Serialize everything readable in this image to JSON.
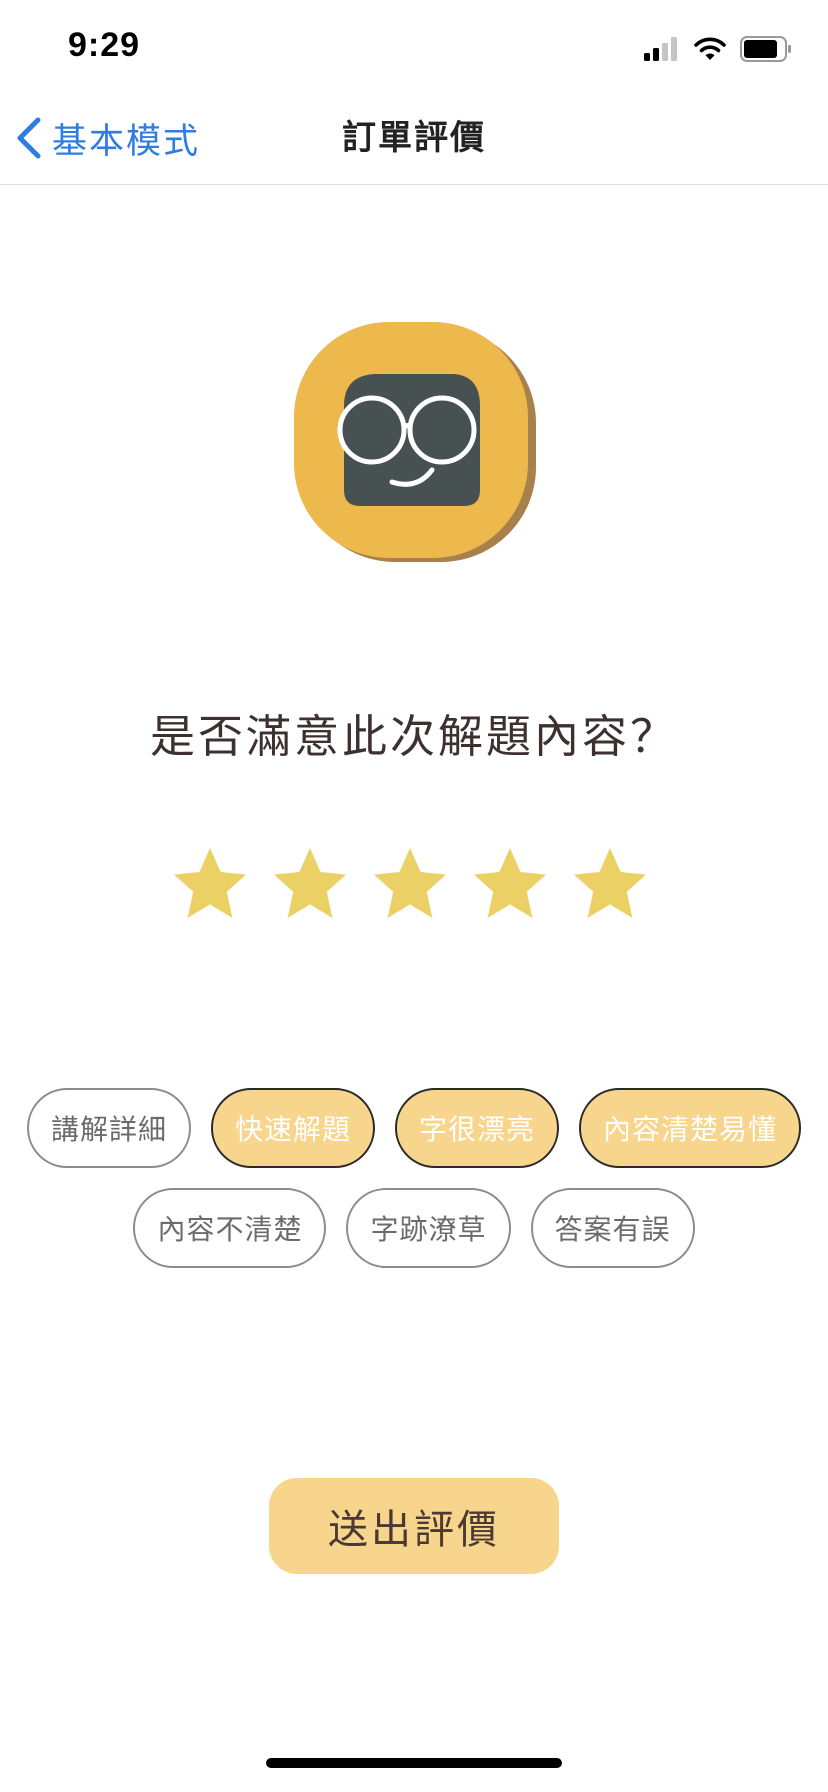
{
  "status_bar": {
    "time": "9:29",
    "icons": [
      "cellular-signal-icon",
      "wifi-icon",
      "battery-icon"
    ]
  },
  "nav": {
    "back_label": "基本模式",
    "title": "訂單評價"
  },
  "mascot": {
    "icon": "glasses-mascot-logo"
  },
  "question": "是否滿意此次解題內容？",
  "rating": {
    "value": 5,
    "max": 5,
    "color": "#ebd165"
  },
  "tags": {
    "row1": [
      {
        "label": "講解詳細",
        "selected": false
      },
      {
        "label": "快速解題",
        "selected": true
      },
      {
        "label": "字很漂亮",
        "selected": true
      },
      {
        "label": "內容清楚易懂",
        "selected": true
      }
    ],
    "row2": [
      {
        "label": "內容不清楚",
        "selected": false
      },
      {
        "label": "字跡潦草",
        "selected": false
      },
      {
        "label": "答案有誤",
        "selected": false
      }
    ]
  },
  "submit_label": "送出評價",
  "colors": {
    "accent": "#f7d58c",
    "link": "#2f7de1",
    "mascot_bg": "#edb84c",
    "mascot_face": "#485152"
  }
}
